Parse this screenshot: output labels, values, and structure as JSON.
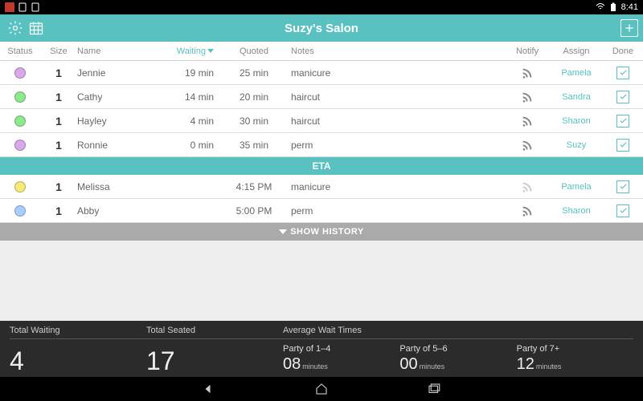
{
  "statusbar": {
    "time": "8:41"
  },
  "header": {
    "title": "Suzy's Salon"
  },
  "columns": {
    "status": "Status",
    "size": "Size",
    "name": "Name",
    "waiting": "Waiting",
    "quoted": "Quoted",
    "notes": "Notes",
    "notify": "Notify",
    "assign": "Assign",
    "done": "Done"
  },
  "sections": {
    "eta": "ETA",
    "show_history": "SHOW HISTORY"
  },
  "rows_waiting": [
    {
      "color": "#d8a8e8",
      "size": "1",
      "name": "Jennie",
      "waiting": "19 min",
      "quoted": "25 min",
      "notes": "manicure",
      "notify_active": true,
      "assign": "Pamela"
    },
    {
      "color": "#8ee88e",
      "size": "1",
      "name": "Cathy",
      "waiting": "14 min",
      "quoted": "20 min",
      "notes": "haircut",
      "notify_active": true,
      "assign": "Sandra"
    },
    {
      "color": "#8ee88e",
      "size": "1",
      "name": "Hayley",
      "waiting": "4 min",
      "quoted": "30 min",
      "notes": "haircut",
      "notify_active": true,
      "assign": "Sharon"
    },
    {
      "color": "#d8a8e8",
      "size": "1",
      "name": "Ronnie",
      "waiting": "0 min",
      "quoted": "35 min",
      "notes": "perm",
      "notify_active": true,
      "assign": "Suzy"
    }
  ],
  "rows_eta": [
    {
      "color": "#f5e97a",
      "size": "1",
      "name": "Melissa",
      "waiting": "",
      "quoted": "4:15 PM",
      "notes": "manicure",
      "notify_active": false,
      "assign": "Pamela"
    },
    {
      "color": "#a8cfff",
      "size": "1",
      "name": "Abby",
      "waiting": "",
      "quoted": "5:00 PM",
      "notes": "perm",
      "notify_active": true,
      "assign": "Sharon"
    }
  ],
  "footer": {
    "total_waiting_label": "Total Waiting",
    "total_seated_label": "Total Seated",
    "avg_label": "Average Wait Times",
    "total_waiting": "4",
    "total_seated": "17",
    "avgs": [
      {
        "label": "Party of 1–4",
        "value": "08",
        "unit": "minutes"
      },
      {
        "label": "Party of 5–6",
        "value": "00",
        "unit": "minutes"
      },
      {
        "label": "Party of 7+",
        "value": "12",
        "unit": "minutes"
      }
    ]
  }
}
